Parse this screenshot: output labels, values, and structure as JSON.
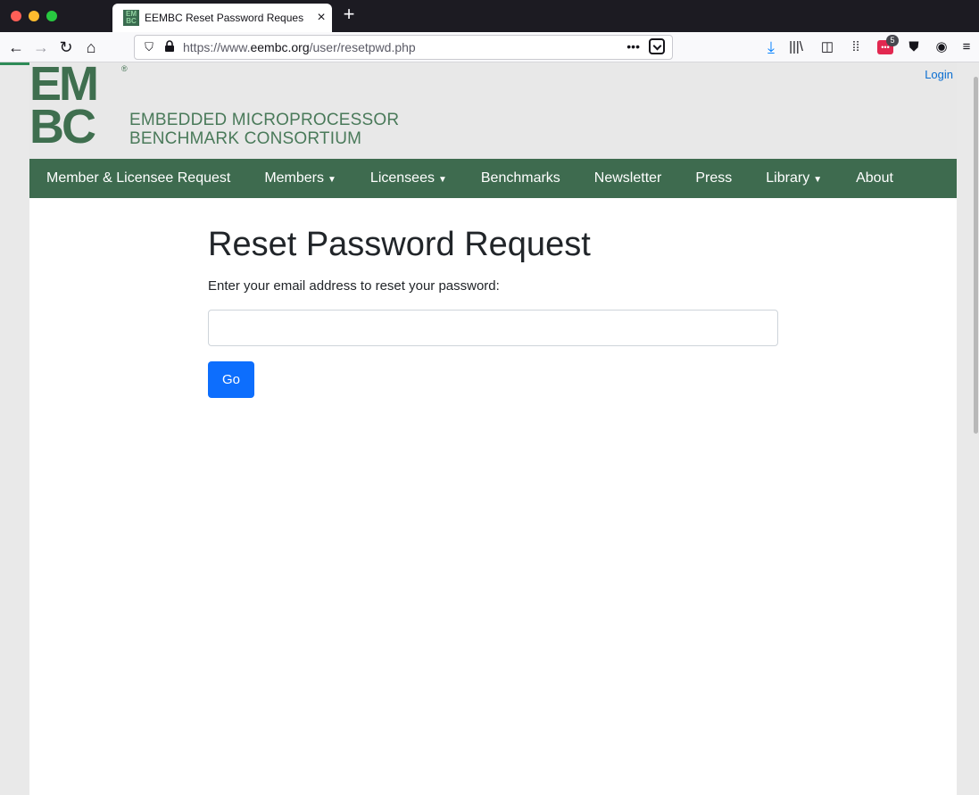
{
  "browser": {
    "tab_title": "EEMBC Reset Password Reques",
    "tab_close_icon": "×",
    "new_tab_icon": "+",
    "url_prefix": "https://www.",
    "url_domain": "eembc.org",
    "url_path": "/user/resetpwd.php",
    "url_dots": "•••",
    "extension_badge_count": "5",
    "extension_badge_label": "•••"
  },
  "header": {
    "logo_line1": "EM",
    "logo_line2": "BC",
    "logo_registered": "®",
    "logo_text_line1": "EMBEDDED MICROPROCESSOR",
    "logo_text_line2": "BENCHMARK CONSORTIUM",
    "login_label": "Login"
  },
  "nav": {
    "items": [
      {
        "label": "Member & Licensee Request",
        "dropdown": false
      },
      {
        "label": "Members",
        "dropdown": true
      },
      {
        "label": "Licensees",
        "dropdown": true
      },
      {
        "label": "Benchmarks",
        "dropdown": false
      },
      {
        "label": "Newsletter",
        "dropdown": false
      },
      {
        "label": "Press",
        "dropdown": false
      },
      {
        "label": "Library",
        "dropdown": true
      },
      {
        "label": "About",
        "dropdown": false
      }
    ],
    "caret": "▼"
  },
  "main": {
    "title": "Reset Password Request",
    "instruction": "Enter your email address to reset your password:",
    "email_value": "",
    "go_label": "Go"
  },
  "colors": {
    "nav_green": "#3e6b4f",
    "logo_green": "#3f6f4f",
    "button_blue": "#0d6efd",
    "link_blue": "#0a6ed1"
  }
}
